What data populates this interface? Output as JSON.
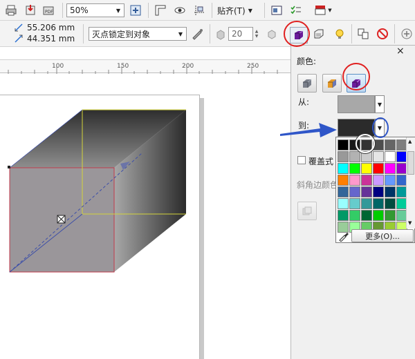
{
  "toolbar1": {
    "zoom": {
      "value": "50%"
    },
    "snap": {
      "label": "贴齐(T)"
    }
  },
  "toolbar2": {
    "width": {
      "value": "55.206 mm"
    },
    "height": {
      "value": "44.351 mm"
    },
    "vanish_point": {
      "value": "灭点锁定到对象"
    },
    "depth": {
      "value": "20"
    }
  },
  "ruler": {
    "ticks": [
      "100",
      "150",
      "200",
      "250"
    ]
  },
  "panel": {
    "close_glyph": "×",
    "color_label": "颜色:",
    "from_label": "从:",
    "to_label": "到:",
    "cover_label": "覆盖式",
    "bevel_label": "斜角边颜色",
    "more_button": "更多(O)...",
    "from_color": "#a8a8a8",
    "to_color": "#2b2b2b"
  },
  "palette": {
    "colors": [
      "#000000",
      "#1a1a1a",
      "#333333",
      "#4d4d4d",
      "#666666",
      "#7f7f7f",
      "#999999",
      "#b2b2b2",
      "#cccccc",
      "#e5e5e5",
      "#ffffff",
      "#0000ff",
      "#00ffff",
      "#00ff00",
      "#ffff00",
      "#ff0000",
      "#ff00ff",
      "#9900cc",
      "#ff7f00",
      "#ff99cc",
      "#cc3399",
      "#cc99ff",
      "#6699ff",
      "#3366cc",
      "#336699",
      "#6666cc",
      "#663399",
      "#000080",
      "#003366",
      "#009999",
      "#99ffff",
      "#66cccc",
      "#339999",
      "#006666",
      "#004d40",
      "#00cc99",
      "#009966",
      "#33cc66",
      "#006633",
      "#00cc00",
      "#339933",
      "#66cc99",
      "#99cc99",
      "#99ff99",
      "#66cc66",
      "#669933",
      "#99cc33",
      "#ccff66"
    ]
  },
  "colors": {
    "accent_circle": "#e02020",
    "annotation_blue": "#2f56c8",
    "box_edge_red": "#c0394b",
    "box_edge_yellow": "#d4d43a",
    "box_edge_blue": "#3c4ea8"
  }
}
